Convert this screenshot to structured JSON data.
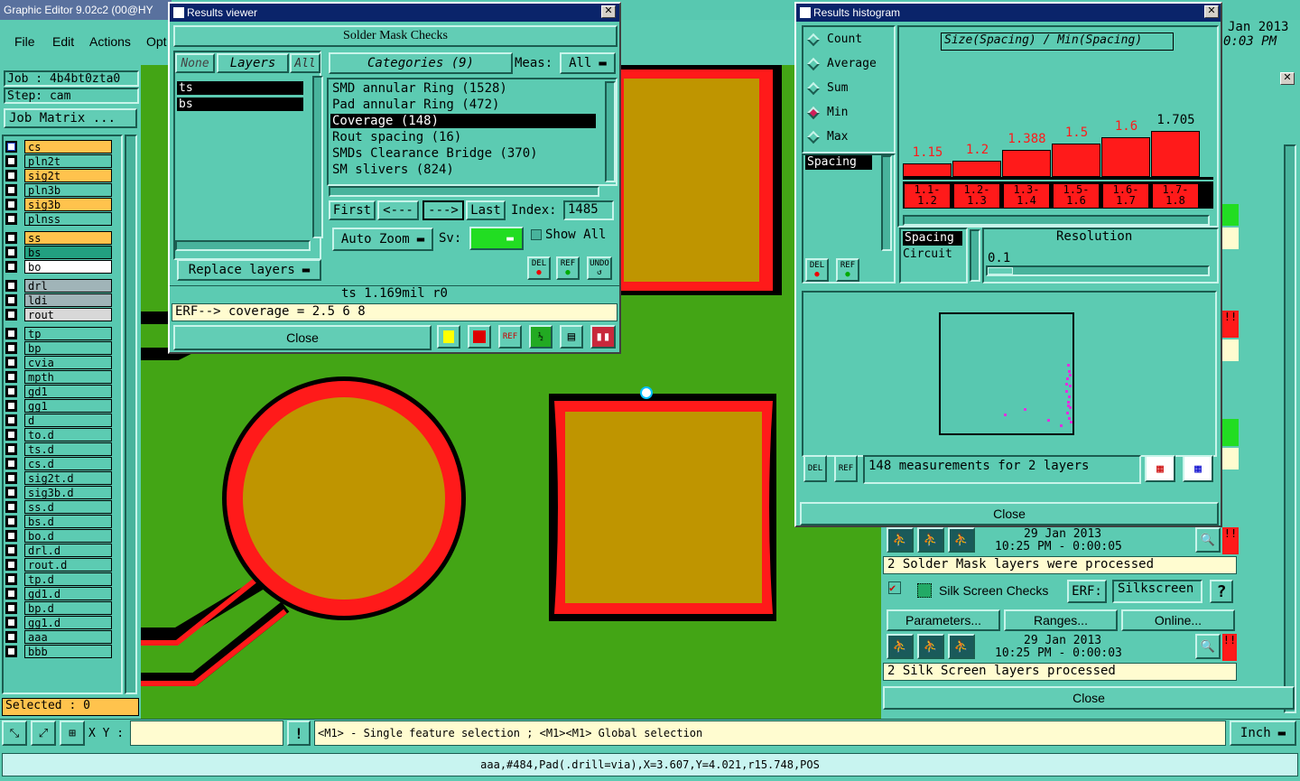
{
  "app": {
    "title": "Graphic Editor 9.02c2 (00@HY",
    "menu": [
      "File",
      "Edit",
      "Actions",
      "Opt"
    ],
    "date_line1": "Jan 2013",
    "date_line2": "0:03 PM"
  },
  "left": {
    "job": "Job : 4b4bt0zta0",
    "step": "Step: cam",
    "job_matrix": "Job Matrix ...",
    "selected": "Selected : 0",
    "layers": [
      "cs",
      "pln2t",
      "sig2t",
      "pln3b",
      "sig3b",
      "plnss",
      "ss",
      "bs",
      "bo",
      "drl",
      "ldi",
      "rout",
      "tp",
      "bp",
      "cvia",
      "mpth",
      "gd1",
      "gg1",
      "d",
      "to.d",
      "ts.d",
      "cs.d",
      "sig2t.d",
      "sig3b.d",
      "ss.d",
      "bs.d",
      "bo.d",
      "drl.d",
      "rout.d",
      "tp.d",
      "gd1.d",
      "bp.d",
      "gg1.d",
      "aaa",
      "bbb"
    ]
  },
  "results_viewer": {
    "title": "Results viewer",
    "header": "Solder Mask Checks",
    "none": "None",
    "layers": "Layers",
    "all": "All",
    "layer_list": [
      "ts",
      "bs"
    ],
    "categories": "Categories (9)",
    "meas_label": "Meas:",
    "meas_value": "All",
    "cats": [
      "SMD annular Ring (1528)",
      "Pad annular Ring (472)",
      "Coverage (148)",
      "Rout spacing (16)",
      "SMDs Clearance Bridge (370)",
      "SM slivers (824)"
    ],
    "first": "First",
    "prev": "<---",
    "next": "--->",
    "last": "Last",
    "index_label": "Index:",
    "index_value": "1485",
    "auto_zoom": "Auto Zoom",
    "sv": "Sv:",
    "show_all": "Show All",
    "replace": "Replace layers",
    "del": "DEL",
    "ref": "REF",
    "undo": "UNDO",
    "status": "ts 1.169mil  r0",
    "erf": "ERF--> coverage = 2.5 6 8",
    "close": "Close",
    "ref2": "REF"
  },
  "histogram": {
    "title": "Results histogram",
    "opts": [
      "Count",
      "Average",
      "Sum",
      "Min",
      "Max"
    ],
    "heading": "Size(Spacing) / Min(Spacing)",
    "bars": [
      {
        "label": "1.15",
        "value": 1.15,
        "cat": "1.1- 1.2"
      },
      {
        "label": "1.2",
        "value": 1.2,
        "cat": "1.2- 1.3"
      },
      {
        "label": "1.388",
        "value": 1.388,
        "cat": "1.3- 1.4"
      },
      {
        "label": "1.5",
        "value": 1.5,
        "cat": "1.5- 1.6"
      },
      {
        "label": "1.6",
        "value": 1.6,
        "cat": "1.6- 1.7"
      },
      {
        "label": "1.705",
        "value": 1.705,
        "cat": "1.7- 1.8"
      }
    ],
    "field": "Spacing",
    "field_list": [
      "Spacing",
      "Circuit"
    ],
    "resolution": "Resolution",
    "res_value": "0.1",
    "meas": "148 measurements for 2 layers",
    "close": "Close",
    "del": "DEL",
    "ref": "REF"
  },
  "checks": {
    "date1": "29 Jan 2013",
    "time1": "10:25 PM - 0:00:05",
    "msg1": "2 Solder Mask layers were processed",
    "silk": "Silk Screen Checks",
    "erf": "ERF:",
    "erf_value": "Silkscreen",
    "help": "?",
    "params": "Parameters...",
    "ranges": "Ranges...",
    "online": "Online...",
    "date2": "29 Jan 2013",
    "time2": "10:25 PM - 0:00:03",
    "msg2": "2 Silk Screen layers processed",
    "close": "Close"
  },
  "bottom": {
    "xy": "X Y :",
    "excl": "!",
    "hint": "<M1> - Single feature selection ; <M1><M1> Global selection",
    "unit": "Inch",
    "feature": "aaa,#484,Pad(.drill=via),X=3.607,Y=4.021,r15.748,POS"
  },
  "colors": {
    "board": "#43a515",
    "mask": "#ff1a1a",
    "copper": "#bf9500",
    "teal": "#5ccbb2"
  }
}
